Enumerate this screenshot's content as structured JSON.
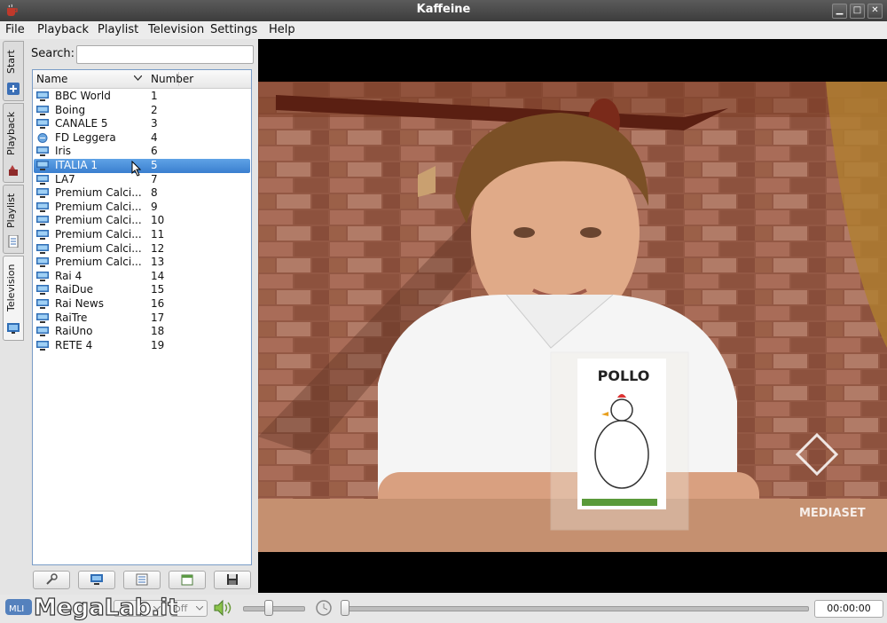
{
  "window": {
    "title": "Kaffeine"
  },
  "menu": [
    "File",
    "Playback",
    "Playlist",
    "Television",
    "Settings",
    "Help"
  ],
  "side_tabs": [
    "Start",
    "Playback",
    "Playlist",
    "Television"
  ],
  "search": {
    "label": "Search:",
    "value": ""
  },
  "channel_list": {
    "columns": [
      "Name",
      "Number"
    ],
    "rows": [
      {
        "name": "BBC World",
        "number": "1"
      },
      {
        "name": "Boing",
        "number": "2"
      },
      {
        "name": "CANALE 5",
        "number": "3"
      },
      {
        "name": "FD Leggera",
        "number": "4"
      },
      {
        "name": "Iris",
        "number": "6"
      },
      {
        "name": "ITALIA 1",
        "number": "5"
      },
      {
        "name": "LA7",
        "number": "7"
      },
      {
        "name": "Premium Calci...",
        "number": "8"
      },
      {
        "name": "Premium Calci...",
        "number": "9"
      },
      {
        "name": "Premium Calci...",
        "number": "10"
      },
      {
        "name": "Premium Calci...",
        "number": "11"
      },
      {
        "name": "Premium Calci...",
        "number": "12"
      },
      {
        "name": "Premium Calci...",
        "number": "13"
      },
      {
        "name": "Rai 4",
        "number": "14"
      },
      {
        "name": "RaiDue",
        "number": "15"
      },
      {
        "name": "Rai News",
        "number": "16"
      },
      {
        "name": "RaiTre",
        "number": "17"
      },
      {
        "name": "RaiUno",
        "number": "18"
      },
      {
        "name": "RETE 4",
        "number": "19"
      }
    ],
    "selected_index": 5
  },
  "video": {
    "sign_text": "POLLO",
    "channel_logo": "MEDIASET"
  },
  "bottom": {
    "deinterlace": "off",
    "time": "00:00:00"
  },
  "watermark": "MegaLab.it",
  "colors": {
    "selection": "#3a7fcf",
    "titlebar": "#444444"
  }
}
